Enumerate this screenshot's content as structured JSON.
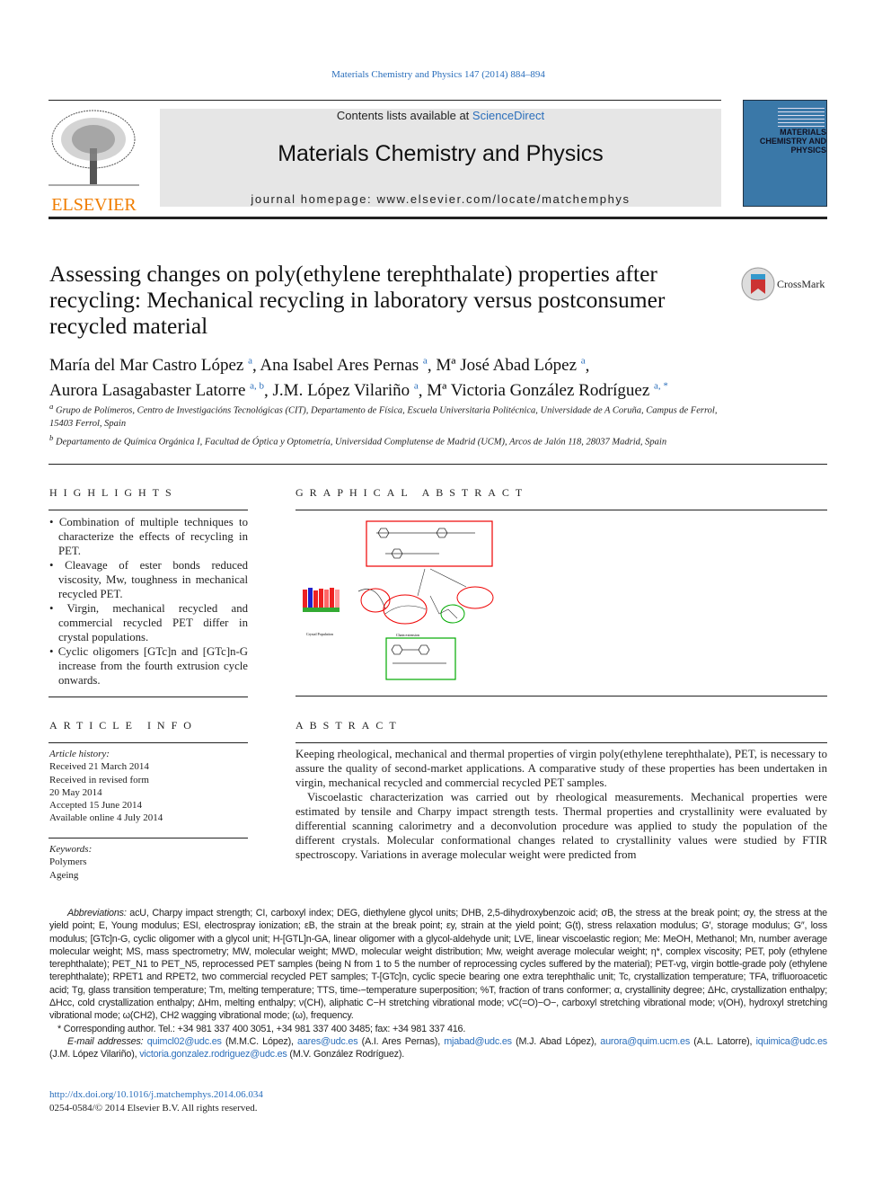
{
  "header": {
    "journal_ref": "Materials Chemistry and Physics 147 (2014) 884–894",
    "contents_prefix": "Contents lists available at ",
    "contents_link": "ScienceDirect",
    "journal_title": "Materials Chemistry and Physics",
    "homepage": "journal homepage: www.elsevier.com/locate/matchemphys",
    "publisher": "ELSEVIER",
    "cover_text": "MATERIALS CHEMISTRY AND PHYSICS",
    "crossmark": "CrossMark"
  },
  "article": {
    "title": "Assessing changes on poly(ethylene terephthalate) properties after recycling: Mechanical recycling in laboratory versus postconsumer recycled material",
    "authors": [
      {
        "name": "María del Mar Castro López",
        "sup": "a"
      },
      {
        "name": "Ana Isabel Ares Pernas",
        "sup": "a"
      },
      {
        "name": "Mª José Abad López",
        "sup": "a"
      },
      {
        "name": "Aurora Lasagabaster Latorre",
        "sup": "a, b"
      },
      {
        "name": "J.M. López Vilariño",
        "sup": "a"
      },
      {
        "name": "Mª Victoria González Rodríguez",
        "sup": "a, *"
      }
    ],
    "affiliations": [
      {
        "sup": "a",
        "text": "Grupo de Polímeros, Centro de Investigacións Tecnológicas (CIT), Departamento de Física, Escuela Universitaria Politécnica, Universidade de A Coruña, Campus de Ferrol, 15403 Ferrol, Spain"
      },
      {
        "sup": "b",
        "text": "Departamento de Química Orgánica I, Facultad de Óptica y Optometría, Universidad Complutense de Madrid (UCM), Arcos de Jalón 118, 28037 Madrid, Spain"
      }
    ]
  },
  "highlights": {
    "heading": "HIGHLIGHTS",
    "items": [
      "Combination of multiple techniques to characterize the effects of recycling in PET.",
      "Cleavage of ester bonds reduced viscosity, Mw, toughness in mechanical recycled PET.",
      "Virgin, mechanical recycled and commercial recycled PET differ in crystal populations.",
      "Cyclic oligomers [GTc]n and [GTc]n-G increase from the fourth extrusion cycle onwards."
    ]
  },
  "graphical_abstract": {
    "heading": "GRAPHICAL ABSTRACT",
    "label_left": "Crystal Population",
    "label_mid": "Chain extension"
  },
  "article_info": {
    "heading": "ARTICLE INFO",
    "history_label": "Article history:",
    "history": [
      "Received 21 March 2014",
      "Received in revised form",
      "20 May 2014",
      "Accepted 15 June 2014",
      "Available online 4 July 2014"
    ],
    "keywords_label": "Keywords:",
    "keywords": [
      "Polymers",
      "Ageing"
    ]
  },
  "abstract": {
    "heading": "ABSTRACT",
    "paragraphs": [
      "Keeping rheological, mechanical and thermal properties of virgin poly(ethylene terephthalate), PET, is necessary to assure the quality of second-market applications. A comparative study of these properties has been undertaken in virgin, mechanical recycled and commercial recycled PET samples.",
      "Viscoelastic characterization was carried out by rheological measurements. Mechanical properties were estimated by tensile and Charpy impact strength tests. Thermal properties and crystallinity were evaluated by differential scanning calorimetry and a deconvolution procedure was applied to study the population of the different crystals. Molecular conformational changes related to crystallinity values were studied by FTIR spectroscopy. Variations in average molecular weight were predicted from"
    ]
  },
  "footnotes": {
    "abbrev_label": "Abbreviations:",
    "abbreviations": " acU, Charpy impact strength; CI, carboxyl index; DEG, diethylene glycol units; DHB, 2,5-dihydroxybenzoic acid; σB, the stress at the break point; σy, the stress at the yield point; E, Young modulus; ESI, electrospray ionization; εB, the strain at the break point; εy, strain at the yield point; G(t), stress relaxation modulus; G′, storage modulus; G″, loss modulus; [GTc]n-G, cyclic oligomer with a glycol unit; H-[GTL]n-GA, linear oligomer with a glycol-aldehyde unit; LVE, linear viscoelastic region; Me: MeOH, Methanol; Mn, number average molecular weight; MS, mass spectrometry; MW, molecular weight; MWD, molecular weight distribution; Mw, weight average molecular weight; η*, complex viscosity; PET, poly (ethylene terephthalate); PET_N1 to PET_N5, reprocessed PET samples (being N from 1 to 5 the number of reprocessing cycles suffered by the material); PET-vg, virgin bottle-grade poly (ethylene terephthalate); RPET1 and RPET2, two commercial recycled PET samples; T-[GTc]n, cyclic specie bearing one extra terephthalic unit; Tc, crystallization temperature; TFA, trifluoroacetic acid; Tg, glass transition temperature; Tm, melting temperature; TTS, time-−temperature superposition; %T, fraction of trans conformer; α, crystallinity degree; ΔHc, crystallization enthalpy; ΔHcc, cold crystallization enthalpy; ΔHm, melting enthalpy; ν(CH), aliphatic C−H stretching vibrational mode; νC(=O)−O−, carboxyl stretching vibrational mode; ν(OH), hydroxyl stretching vibrational mode; ω(CH2), CH2 wagging vibrational mode; (ω), frequency.",
    "corresponding": "* Corresponding author. Tel.: +34 981 337 400 3051, +34 981 337 400 3485; fax: +34 981 337 416.",
    "email_label": "E-mail addresses:",
    "emails": [
      {
        "addr": "quimcl02@udc.es",
        "who": " (M.M.C. López), "
      },
      {
        "addr": "aares@udc.es",
        "who": " (A.I. Ares Pernas), "
      },
      {
        "addr": "mjabad@udc.es",
        "who": " (M.J. Abad López), "
      },
      {
        "addr": "aurora@quim.ucm.es",
        "who": " (A.L. Latorre), "
      },
      {
        "addr": "iquimica@udc.es",
        "who": " (J.M. López Vilariño), "
      },
      {
        "addr": "victoria.gonzalez.rodriguez@udc.es",
        "who": " (M.V. González Rodríguez)."
      }
    ],
    "doi": "http://dx.doi.org/10.1016/j.matchemphys.2014.06.034",
    "copyright": "0254-0584/© 2014 Elsevier B.V. All rights reserved."
  },
  "colors": {
    "link": "#2a6ebb",
    "elsevier_orange": "#f07d00",
    "cover_blue": "#3a78a8",
    "header_gray": "#e6e6e6"
  }
}
